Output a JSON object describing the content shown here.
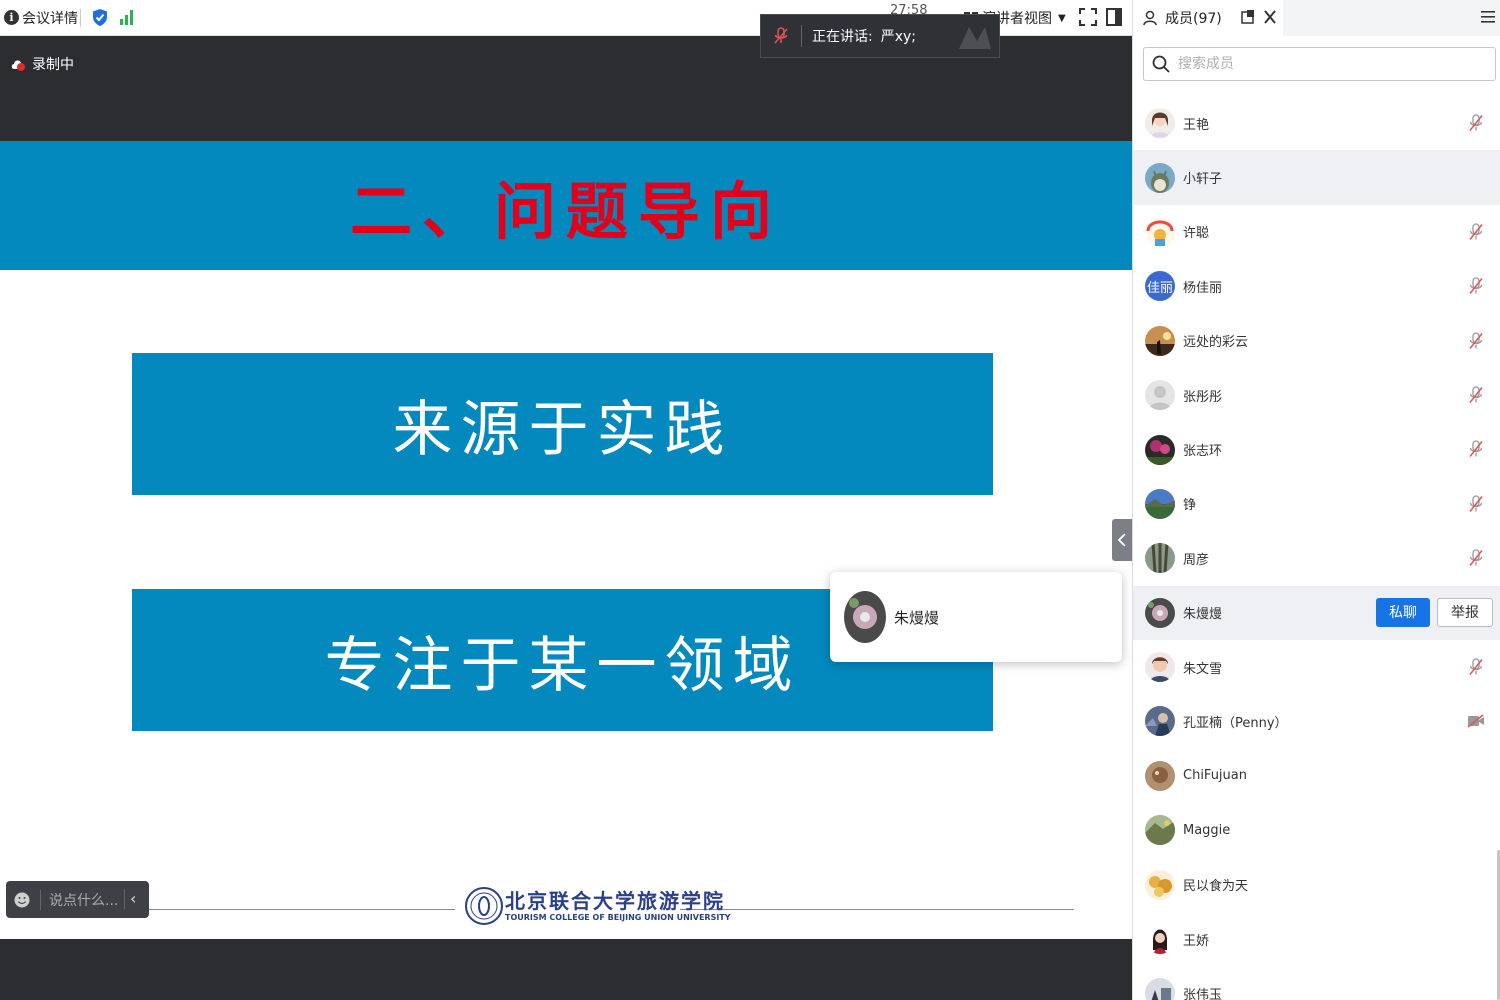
{
  "topbar": {
    "meeting_detail": "会议详情",
    "clock": "27:58",
    "view_mode": "演讲者视图"
  },
  "speaking": {
    "label": "正在讲话:",
    "name": "严xy;"
  },
  "recording": {
    "label": "录制中"
  },
  "slide": {
    "title": "二、问题导向",
    "box1": "来源于实践",
    "box2": "专注于某一领域",
    "school_cn": "北京联合大学旅游学院",
    "school_en": "TOURISM COLLEGE OF BEIJING UNION UNIVERSITY"
  },
  "popup": {
    "name": "朱熳熳"
  },
  "chat": {
    "placeholder": "说点什么..."
  },
  "sidebar": {
    "members_tab": "成员(97)",
    "search_placeholder": "搜索成员",
    "dm_label": "私聊",
    "report_label": "举报",
    "members": [
      {
        "name": "王艳",
        "avatar": "photo-a",
        "status": "mic-muted"
      },
      {
        "name": "小轩子",
        "avatar": "photo-b",
        "status": "none"
      },
      {
        "name": "许聪",
        "avatar": "photo-c",
        "status": "mic-muted"
      },
      {
        "name": "杨佳丽",
        "avatar": "text",
        "avatar_text": "佳丽",
        "status": "mic-muted"
      },
      {
        "name": "远处的彩云",
        "avatar": "photo-d",
        "status": "mic-muted"
      },
      {
        "name": "张彤彤",
        "avatar": "default",
        "status": "mic-muted"
      },
      {
        "name": "张志环",
        "avatar": "photo-e",
        "status": "mic-muted"
      },
      {
        "name": "铮",
        "avatar": "photo-f",
        "status": "mic-muted"
      },
      {
        "name": "周彦",
        "avatar": "photo-g",
        "status": "mic-muted"
      },
      {
        "name": "朱熳熳",
        "avatar": "photo-h",
        "status": "actions"
      },
      {
        "name": "朱文雪",
        "avatar": "photo-i",
        "status": "mic-muted"
      },
      {
        "name": "孔亚楠（Penny）",
        "avatar": "photo-j",
        "status": "cam-off"
      },
      {
        "name": "ChiFujuan",
        "avatar": "photo-k",
        "status": "none"
      },
      {
        "name": "Maggie",
        "avatar": "photo-l",
        "status": "none"
      },
      {
        "name": "民以食为天",
        "avatar": "photo-m",
        "status": "none"
      },
      {
        "name": "王娇",
        "avatar": "photo-n",
        "status": "none"
      },
      {
        "name": "张伟玉",
        "avatar": "photo-o",
        "status": "none"
      }
    ]
  },
  "colors": {
    "accent": "#1774e6",
    "slide_blue": "#0389bd",
    "title_red": "#e3001b",
    "dark_bg": "#2b2d31"
  }
}
